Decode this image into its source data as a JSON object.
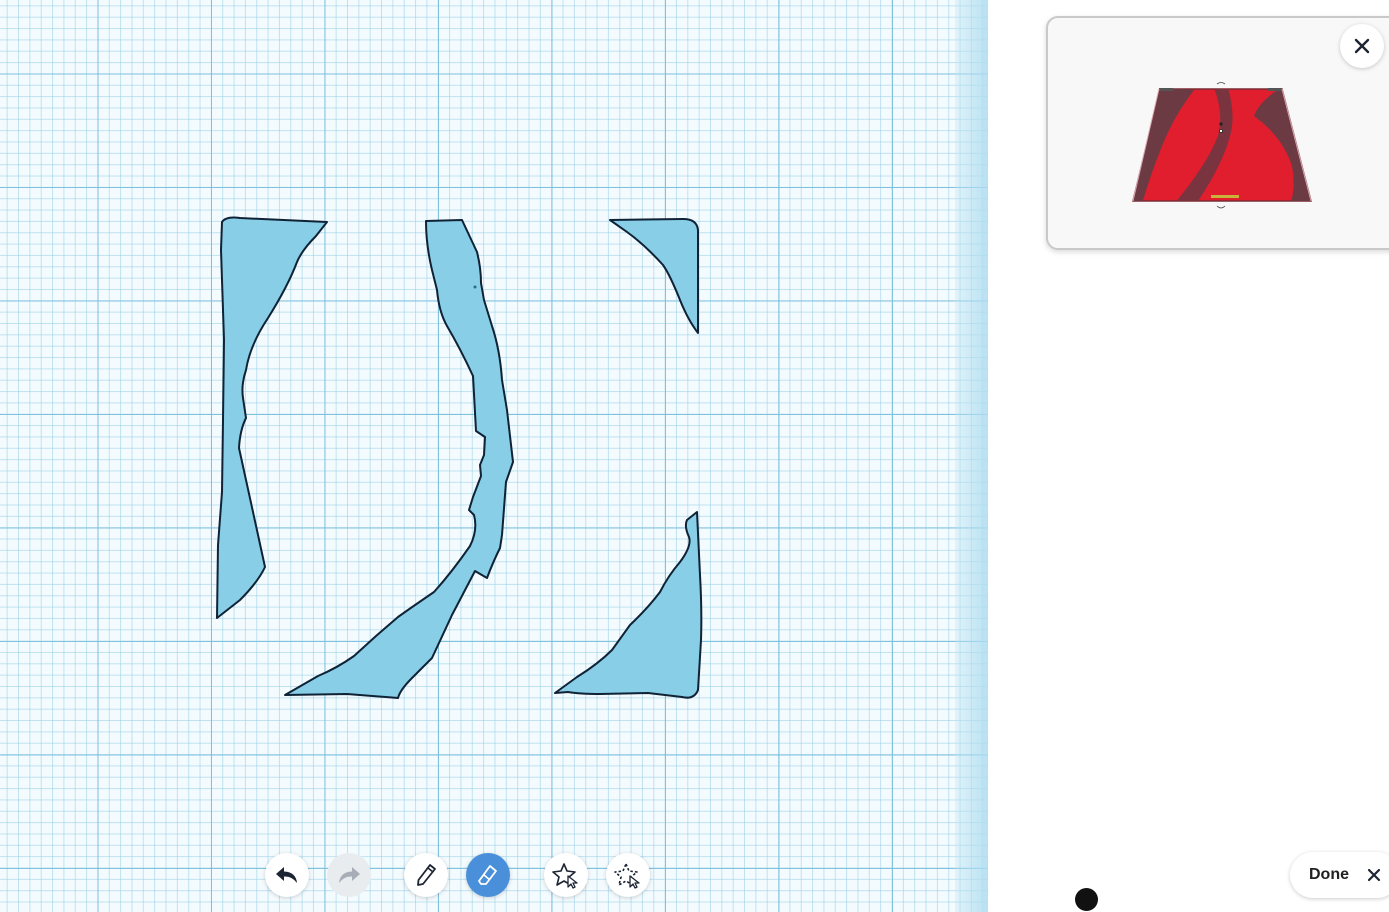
{
  "toolbar": {
    "tools": [
      {
        "id": "undo",
        "icon": "undo-arrow-icon",
        "state": "enabled"
      },
      {
        "id": "redo",
        "icon": "redo-arrow-icon",
        "state": "disabled"
      },
      {
        "id": "pencil",
        "icon": "pencil-icon",
        "state": "enabled"
      },
      {
        "id": "eraser",
        "icon": "eraser-icon",
        "state": "active"
      },
      {
        "id": "shape-add",
        "icon": "star-cursor-icon",
        "state": "enabled"
      },
      {
        "id": "shape-select",
        "icon": "dashed-star-cursor-icon",
        "state": "enabled"
      }
    ]
  },
  "preview": {
    "close_icon": "close-icon",
    "model_color": "#e01e2e"
  },
  "footer": {
    "done_label": "Done",
    "done_icon": "close-icon"
  },
  "colors": {
    "shape_fill": "#87cee6",
    "shape_stroke": "#0f2236",
    "active_tool": "#4a8fd9"
  }
}
